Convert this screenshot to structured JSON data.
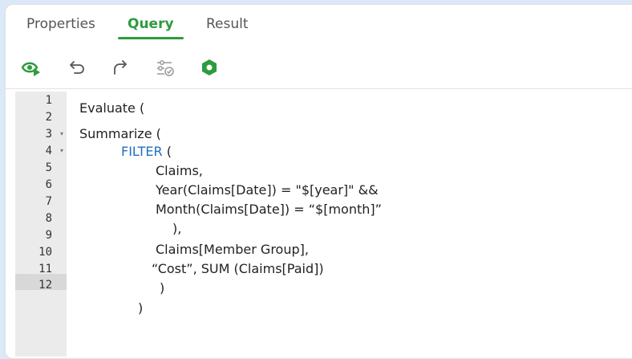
{
  "tabs": [
    {
      "label": "Properties",
      "active": false
    },
    {
      "label": "Query",
      "active": true
    },
    {
      "label": "Result",
      "active": false
    }
  ],
  "toolbar": {
    "icons": [
      "preview-run-icon",
      "undo-icon",
      "redo-icon",
      "settings-check-icon",
      "hexagon-icon"
    ]
  },
  "editor": {
    "line_numbers": [
      "1",
      "2",
      "3",
      "4",
      "5",
      "6",
      "7",
      "8",
      "9",
      "10",
      "11",
      "12"
    ],
    "fold_markers": [
      "▾",
      "▾"
    ],
    "lines": {
      "l1": "Evaluate (",
      "l3": "Summarize (",
      "l4_kw": "FILTER",
      "l4_rest": " (",
      "l5": "Claims,",
      "l6": "Year(Claims[Date]) = \"$[year]\" &&",
      "l7": "Month(Claims[Date]) = “$[month]”",
      "l8": "),",
      "l9": "Claims[Member Group],",
      "l10": "“Cost”, SUM (Claims[Paid])",
      "l11": ")",
      "l12": ")"
    }
  },
  "colors": {
    "accent": "#2e9b3e",
    "keyword": "#1f6fbf"
  }
}
